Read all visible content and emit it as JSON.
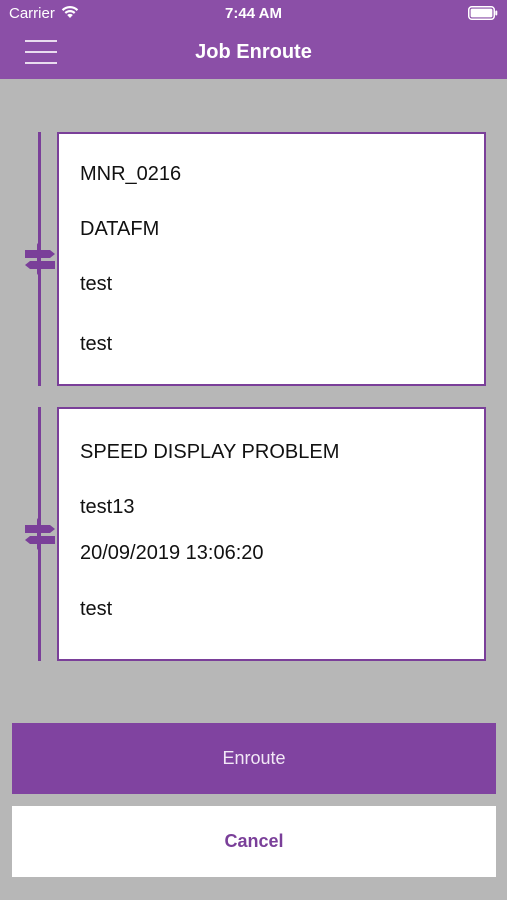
{
  "status_bar": {
    "carrier": "Carrier",
    "time": "7:44 AM",
    "wifi_icon": "wifi-icon",
    "battery_icon": "battery-icon"
  },
  "header": {
    "title": "Job Enroute",
    "menu_icon": "hamburger-menu-icon",
    "background": "#8b4fa7"
  },
  "jobs": [
    {
      "lines": [
        "MNR_0216",
        "DATAFM",
        "test",
        "test"
      ],
      "icon": "signpost-icon"
    },
    {
      "lines": [
        "SPEED DISPLAY PROBLEM",
        "test13",
        "20/09/2019 13:06:20",
        "test"
      ],
      "icon": "signpost-icon"
    }
  ],
  "actions": {
    "enroute_label": "Enroute",
    "cancel_label": "Cancel"
  },
  "colors": {
    "accent": "#8043a0",
    "background": "#b7b7b7",
    "card_border": "#7a3f99"
  }
}
